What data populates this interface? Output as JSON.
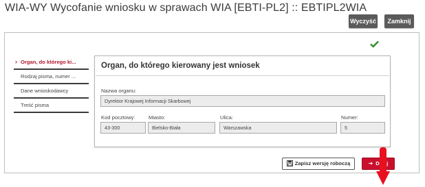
{
  "header": {
    "title": "WIA-WY Wycofanie wniosku w sprawach WIA [EBTI-PL2] :: EBTIPL2WIA",
    "clear_label": "Wyczyść",
    "close_label": "Zamknij"
  },
  "steps": [
    {
      "label": "Organ, do którego ki...",
      "active": true
    },
    {
      "label": "Rodzaj pisma, numer ...",
      "active": false
    },
    {
      "label": "Dane wnioskodawcy",
      "active": false
    },
    {
      "label": "Treść pisma",
      "active": false
    }
  ],
  "panel": {
    "title": "Organ, do którego kierowany jest wniosek",
    "fields": {
      "authority_label": "Nazwa organu:",
      "authority_value": "Dyrektor Krajowej Informacji Skarbowej",
      "postal_label": "Kod pocztowy:",
      "postal_value": "43-300",
      "city_label": "Miasto:",
      "city_value": "Bielsko-Biała",
      "street_label": "Ulica:",
      "street_value": "Warszawska",
      "number_label": "Numer:",
      "number_value": "5"
    }
  },
  "actions": {
    "save_draft_label": "Zapisz wersję roboczą",
    "next_label": "Dalej"
  },
  "status": {
    "icon": "checkmark-icon",
    "color": "#2e8b2e"
  },
  "colors": {
    "accent": "#c8102e",
    "dark_button": "#5b5b5b"
  }
}
